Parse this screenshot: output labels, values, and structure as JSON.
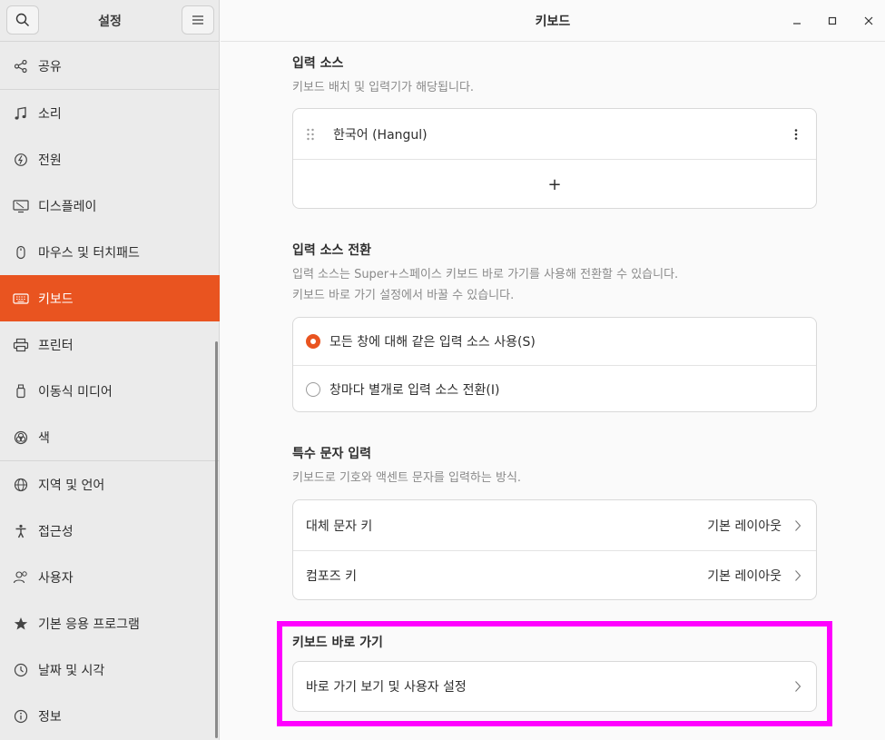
{
  "sidebar": {
    "title": "설정",
    "items": [
      {
        "label": "공유",
        "icon": "share-icon"
      },
      {
        "label": "소리",
        "icon": "music-note-icon"
      },
      {
        "label": "전원",
        "icon": "power-icon"
      },
      {
        "label": "디스플레이",
        "icon": "display-icon"
      },
      {
        "label": "마우스 및 터치패드",
        "icon": "mouse-icon"
      },
      {
        "label": "키보드",
        "icon": "keyboard-icon"
      },
      {
        "label": "프린터",
        "icon": "printer-icon"
      },
      {
        "label": "이동식 미디어",
        "icon": "removable-media-icon"
      },
      {
        "label": "색",
        "icon": "color-icon"
      },
      {
        "label": "지역 및 언어",
        "icon": "globe-icon"
      },
      {
        "label": "접근성",
        "icon": "accessibility-icon"
      },
      {
        "label": "사용자",
        "icon": "users-icon"
      },
      {
        "label": "기본 응용 프로그램",
        "icon": "star-icon"
      },
      {
        "label": "날짜 및 시각",
        "icon": "clock-icon"
      },
      {
        "label": "정보",
        "icon": "info-icon"
      }
    ]
  },
  "header": {
    "title": "키보드"
  },
  "input_sources": {
    "title": "입력 소스",
    "description": "키보드 배치 및 입력기가 해당됩니다.",
    "source_label": "한국어 (Hangul)",
    "add_symbol": "+"
  },
  "switching": {
    "title": "입력 소스 전환",
    "description_line1": "입력 소스는 Super+스페이스 키보드 바로 가기를 사용해 전환할 수 있습니다.",
    "description_line2": "키보드 바로 가기 설정에서 바꿀 수 있습니다.",
    "option_same": "모든 창에 대해 같은 입력 소스 사용(S)",
    "option_per_window": "창마다 별개로 입력 소스 전환(I)"
  },
  "special_chars": {
    "title": "특수 문자 입력",
    "description": "키보드로 기호와 액센트 문자를 입력하는 방식.",
    "alternate_label": "대체 문자 키",
    "alternate_value": "기본 레이아웃",
    "compose_label": "컴포즈 키",
    "compose_value": "기본 레이아웃"
  },
  "shortcuts": {
    "title": "키보드 바로 가기",
    "view_label": "바로 가기 보기 및 사용자 설정"
  },
  "colors": {
    "accent": "#e95420",
    "highlight": "#ff00ff"
  }
}
